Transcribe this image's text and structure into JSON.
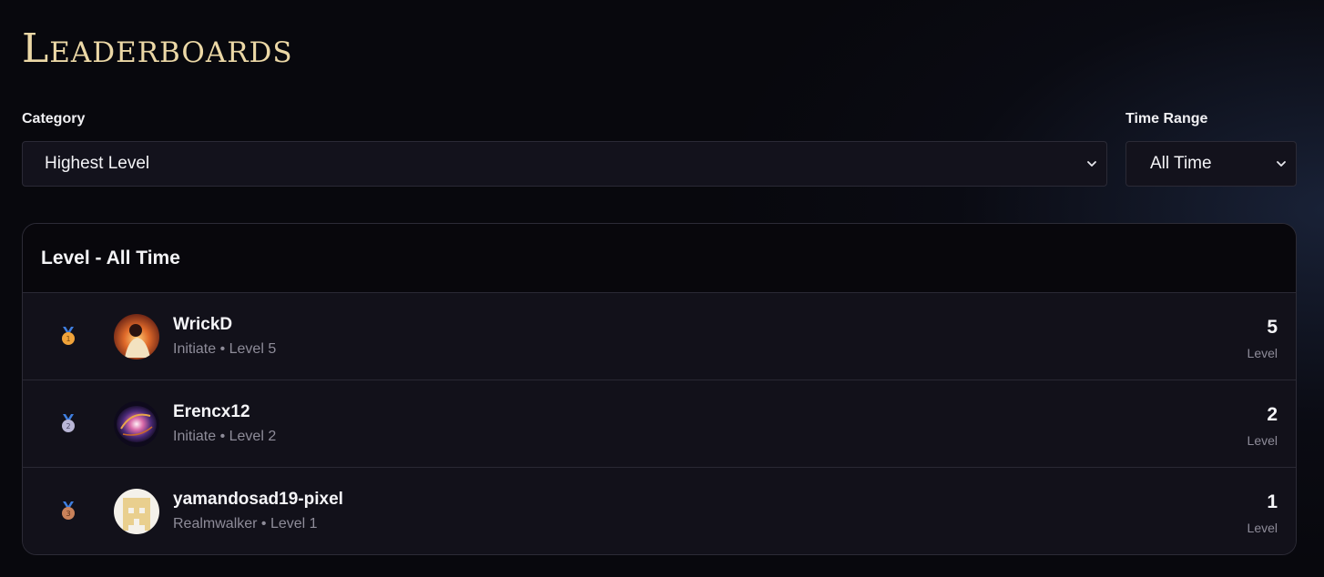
{
  "page": {
    "title": "Leaderboards"
  },
  "filters": {
    "category": {
      "label": "Category",
      "value": "Highest Level"
    },
    "time_range": {
      "label": "Time Range",
      "value": "All Time"
    }
  },
  "board": {
    "title": "Level - All Time",
    "rows": [
      {
        "rank": "1",
        "name": "WrickD",
        "subtitle": "Initiate • Level 5",
        "score": "5",
        "unit": "Level",
        "medal_color": "#f0a33a"
      },
      {
        "rank": "2",
        "name": "Erencx12",
        "subtitle": "Initiate • Level 2",
        "score": "2",
        "unit": "Level",
        "medal_color": "#b9b6d6"
      },
      {
        "rank": "3",
        "name": "yamandosad19-pixel",
        "subtitle": "Realmwalker • Level 1",
        "score": "1",
        "unit": "Level",
        "medal_color": "#c9825a"
      }
    ]
  },
  "colors": {
    "title_gold": "#ecd8a6",
    "ribbon_blue": "#3f7fe0",
    "background": "#08080d",
    "card": "#12111a"
  },
  "icons": [
    "chevron-down-icon",
    "medal-icon",
    "avatar"
  ]
}
